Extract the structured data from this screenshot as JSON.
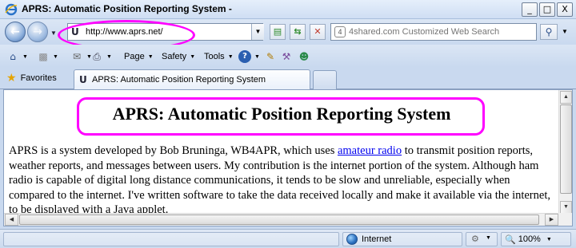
{
  "window": {
    "title": "APRS: Automatic Position Reporting System -",
    "minimize": "_",
    "maximize": "□",
    "close": "X"
  },
  "navbar": {
    "url": "http://www.aprs.net/",
    "search_placeholder": "4shared.com Customized Web Search"
  },
  "command_bar": {
    "page_label": "Page",
    "safety_label": "Safety",
    "tools_label": "Tools"
  },
  "tabs": {
    "favorites_label": "Favorites",
    "active_tab_label": "APRS: Automatic Position Reporting System"
  },
  "page": {
    "heading": "APRS: Automatic Position Reporting System",
    "body_before_link": "APRS is a system developed by Bob Bruninga, WB4APR, which uses ",
    "link_text": "amateur radio",
    "body_after_link": " to transmit position reports, weather reports, and messages between users. My contribution is the internet portion of the system. Although ham radio is capable of digital long distance communications, it tends to be slow and unreliable, especially when compared to the internet. I've written software to take the data received locally and make it available via the internet, to be displayed with a Java applet."
  },
  "statusbar": {
    "zone": "Internet",
    "zoom": "100%"
  },
  "colors": {
    "highlight": "#ff00ff",
    "link": "#0000ee"
  },
  "icons": [
    "ie-logo-icon",
    "back-icon",
    "forward-icon",
    "aprs-favicon",
    "compat-view-icon",
    "refresh-icon",
    "stop-icon",
    "search-icon",
    "home-icon",
    "feeds-icon",
    "mail-icon",
    "print-icon",
    "help-icon",
    "research-icon",
    "star-icon",
    "globe-icon",
    "protected-mode-icon",
    "zoom-icon"
  ]
}
